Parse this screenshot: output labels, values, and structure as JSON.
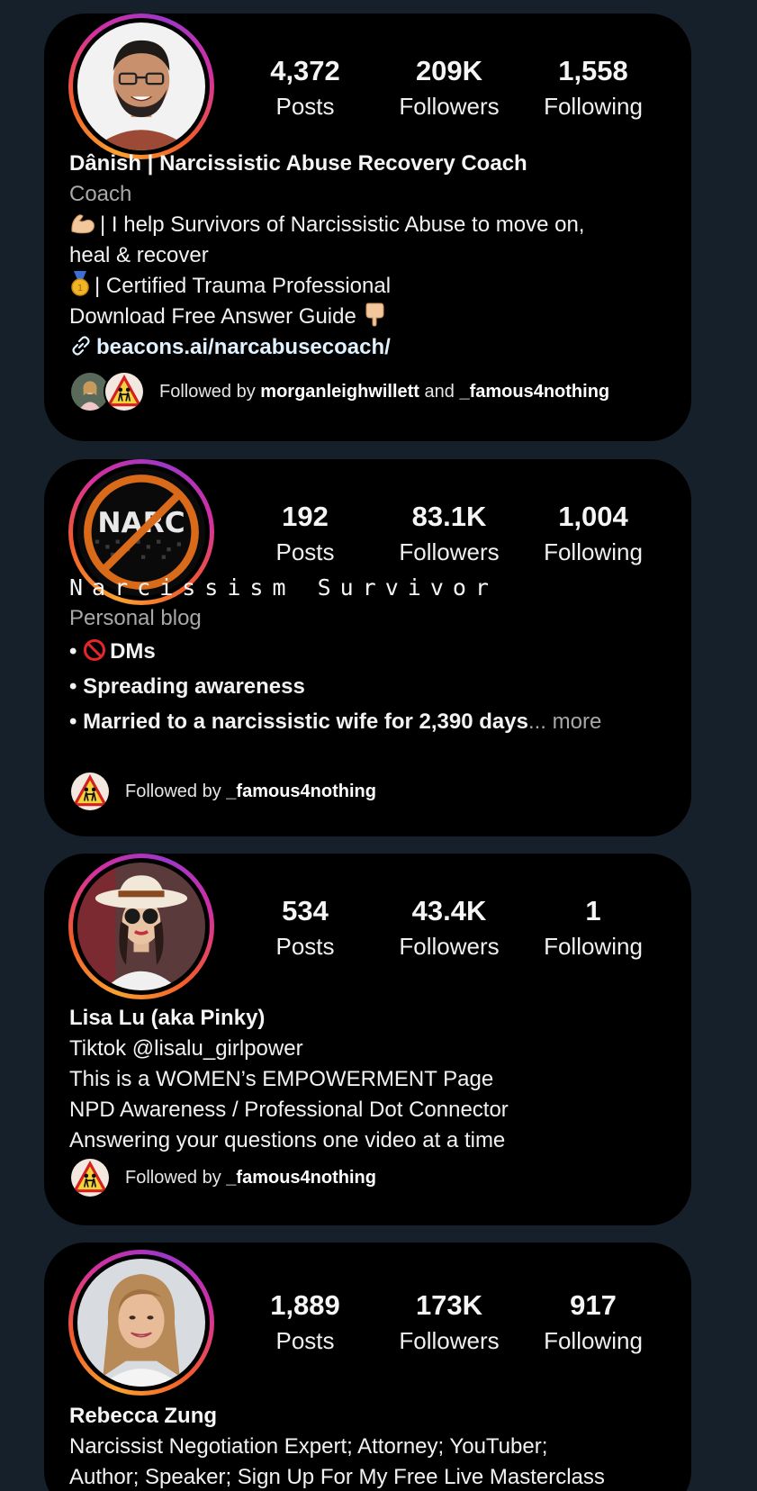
{
  "profiles": [
    {
      "stats": {
        "posts": "4,372",
        "posts_label": "Posts",
        "followers": "209K",
        "followers_label": "Followers",
        "following": "1,558",
        "following_label": "Following"
      },
      "name": "Dânish | Narcissistic Abuse Recovery Coach",
      "category": "Coach",
      "bio_lines": [
        "| I help Survivors of Narcissistic Abuse to move on,",
        "heal & recover",
        "| Certified Trauma Professional",
        "Download Free Answer Guide"
      ],
      "link": "beacons.ai/narcabusecoach/",
      "followed_prefix": "Followed by ",
      "followed_user1": "morganleighwillett",
      "followed_and": " and ",
      "followed_user2": "_famous4nothing",
      "icons": [
        "flexed-biceps-emoji",
        "medal-emoji",
        "pointing-down-emoji",
        "link-icon"
      ]
    },
    {
      "stats": {
        "posts": "192",
        "posts_label": "Posts",
        "followers": "83.1K",
        "followers_label": "Followers",
        "following": "1,004",
        "following_label": "Following"
      },
      "avatar_text": "NARC",
      "name": "Narcissism Survivor",
      "category": "Personal blog",
      "bio_lines": [
        "DMs",
        "Spreading awareness",
        "Married to a narcissistic wife for 2,390 days"
      ],
      "bullet": "•",
      "ellipsis": "...",
      "more": "more",
      "followed_prefix": "Followed by ",
      "followed_user1": "_famous4nothing",
      "icons": [
        "prohibited-emoji"
      ]
    },
    {
      "stats": {
        "posts": "534",
        "posts_label": "Posts",
        "followers": "43.4K",
        "followers_label": "Followers",
        "following": "1",
        "following_label": "Following"
      },
      "name": "Lisa Lu (aka Pinky)",
      "bio_lines": [
        "Tiktok @lisalu_girlpower",
        "This is a WOMEN’s EMPOWERMENT Page",
        "NPD Awareness / Professional Dot Connector",
        "Answering your questions one video at a time"
      ],
      "followed_prefix": "Followed by ",
      "followed_user1": "_famous4nothing"
    },
    {
      "stats": {
        "posts": "1,889",
        "posts_label": "Posts",
        "followers": "173K",
        "followers_label": "Followers",
        "following": "917",
        "following_label": "Following"
      },
      "name": "Rebecca Zung",
      "bio_lines": [
        "Narcissist Negotiation Expert; Attorney; YouTuber;",
        "Author; Speaker; Sign Up For My Free Live Masterclass"
      ]
    }
  ],
  "colors": {
    "page_bg": "#16202b",
    "card_bg": "#000000",
    "secondary_text": "#a8a8a8",
    "story_ring": [
      "#f9a230",
      "#f25b2a",
      "#d42fa0",
      "#9c38c9"
    ]
  }
}
